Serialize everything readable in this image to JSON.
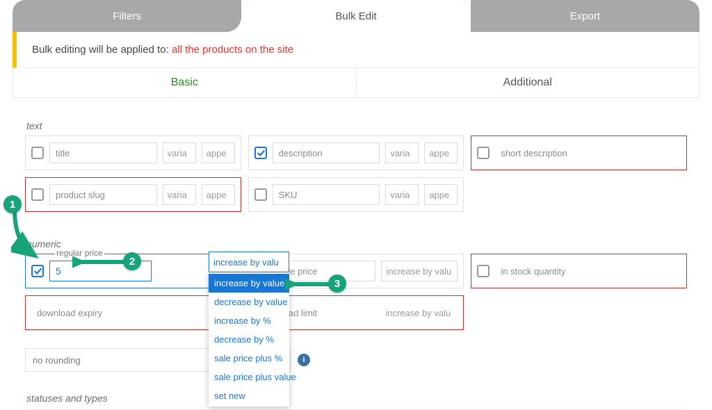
{
  "tabs": {
    "filters": "Filters",
    "bulk": "Bulk Edit",
    "export": "Export"
  },
  "notice": {
    "lead": "Bulk editing will be applied to: ",
    "scope": "all the products on the site"
  },
  "subtabs": {
    "basic": "Basic",
    "additional": "Additional"
  },
  "sections": {
    "text": "text",
    "numeric": "numeric",
    "statuses": "statuses and types"
  },
  "text_fields": {
    "title": {
      "label": "title",
      "var": "varia",
      "mode": "appe",
      "checked": false,
      "err": false
    },
    "description": {
      "label": "description",
      "var": "varia",
      "mode": "appe",
      "checked": true,
      "err": false
    },
    "short_desc": {
      "label": "short description",
      "checked": false,
      "err": true
    },
    "slug": {
      "label": "product slug",
      "var": "varia",
      "mode": "appe",
      "checked": false,
      "err": true
    },
    "sku": {
      "label": "SKU",
      "var": "varia",
      "mode": "appe",
      "checked": false,
      "err": false
    }
  },
  "numeric_fields": {
    "regular_price": {
      "float_label": "regular price",
      "value": "5",
      "select_display": "increase by valu",
      "checked": true,
      "err": false
    },
    "sale_price": {
      "label": "sale price",
      "select": "increase by valu",
      "checked": false,
      "err": false
    },
    "stock_qty": {
      "label": "in stock quantity",
      "checked": false,
      "err": true
    },
    "download_expiry": {
      "label": "download expiry",
      "checked": false,
      "err": true
    },
    "download_limit": {
      "label": "download limit",
      "select": "increase by valu",
      "checked": false,
      "err": true
    }
  },
  "dropdown_options": [
    "increase by value",
    "decrease by value",
    "increase by %",
    "decrease by %",
    "sale price plus %",
    "sale price plus value",
    "set new"
  ],
  "dropdown_selected_index": 0,
  "rounding": {
    "label": "no rounding"
  },
  "annotations": {
    "one": "1",
    "two": "2",
    "three": "3"
  }
}
